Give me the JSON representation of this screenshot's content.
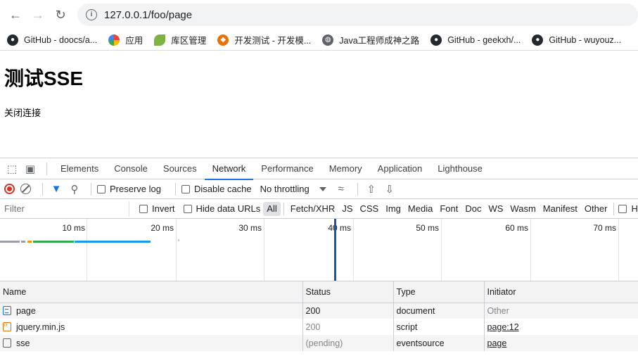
{
  "browser": {
    "url": "127.0.0.1/foo/page",
    "bookmarks": [
      {
        "label": "GitHub - doocs/a...",
        "icon": "github-icon",
        "color": "#24292f"
      },
      {
        "label": "应用",
        "icon": "apps-icon",
        "color": "#4285f4"
      },
      {
        "label": "库区管理",
        "icon": "leaf-icon",
        "color": "#7cb342"
      },
      {
        "label": "开发测试 - 开发模...",
        "icon": "gitlab-icon",
        "color": "#e8710a"
      },
      {
        "label": "Java工程师成神之路",
        "icon": "globe-icon",
        "color": "#5f6368"
      },
      {
        "label": "GitHub - geekxh/...",
        "icon": "github-icon",
        "color": "#24292f"
      },
      {
        "label": "GitHub - wuyouz...",
        "icon": "github-icon",
        "color": "#24292f"
      }
    ]
  },
  "page": {
    "heading": "测试SSE",
    "close_link": "关闭连接"
  },
  "devtools": {
    "tabs": [
      "Elements",
      "Console",
      "Sources",
      "Network",
      "Performance",
      "Memory",
      "Application",
      "Lighthouse"
    ],
    "active_tab": "Network",
    "toolbar": {
      "preserve_log": "Preserve log",
      "disable_cache": "Disable cache",
      "throttling": "No throttling"
    },
    "filter": {
      "placeholder": "Filter",
      "invert": "Invert",
      "hide_data_urls": "Hide data URLs",
      "types": [
        "All",
        "Fetch/XHR",
        "JS",
        "CSS",
        "Img",
        "Media",
        "Font",
        "Doc",
        "WS",
        "Wasm",
        "Manifest",
        "Other"
      ],
      "selected_type": "All",
      "trailing": "H"
    },
    "timeline": {
      "ticks": [
        "10 ms",
        "20 ms",
        "30 ms",
        "40 ms",
        "50 ms",
        "60 ms",
        "70 ms"
      ],
      "load_marker_ms": 39
    },
    "table": {
      "headers": [
        "Name",
        "Status",
        "Type",
        "Initiator"
      ],
      "rows": [
        {
          "name": "page",
          "status": "200",
          "type": "document",
          "initiator": "Other",
          "icon": "document-icon"
        },
        {
          "name": "jquery.min.js",
          "status": "200",
          "type": "script",
          "initiator": "page:12",
          "icon": "script-icon"
        },
        {
          "name": "sse",
          "status": "(pending)",
          "type": "eventsource",
          "initiator": "page",
          "icon": "other-icon"
        }
      ]
    }
  }
}
